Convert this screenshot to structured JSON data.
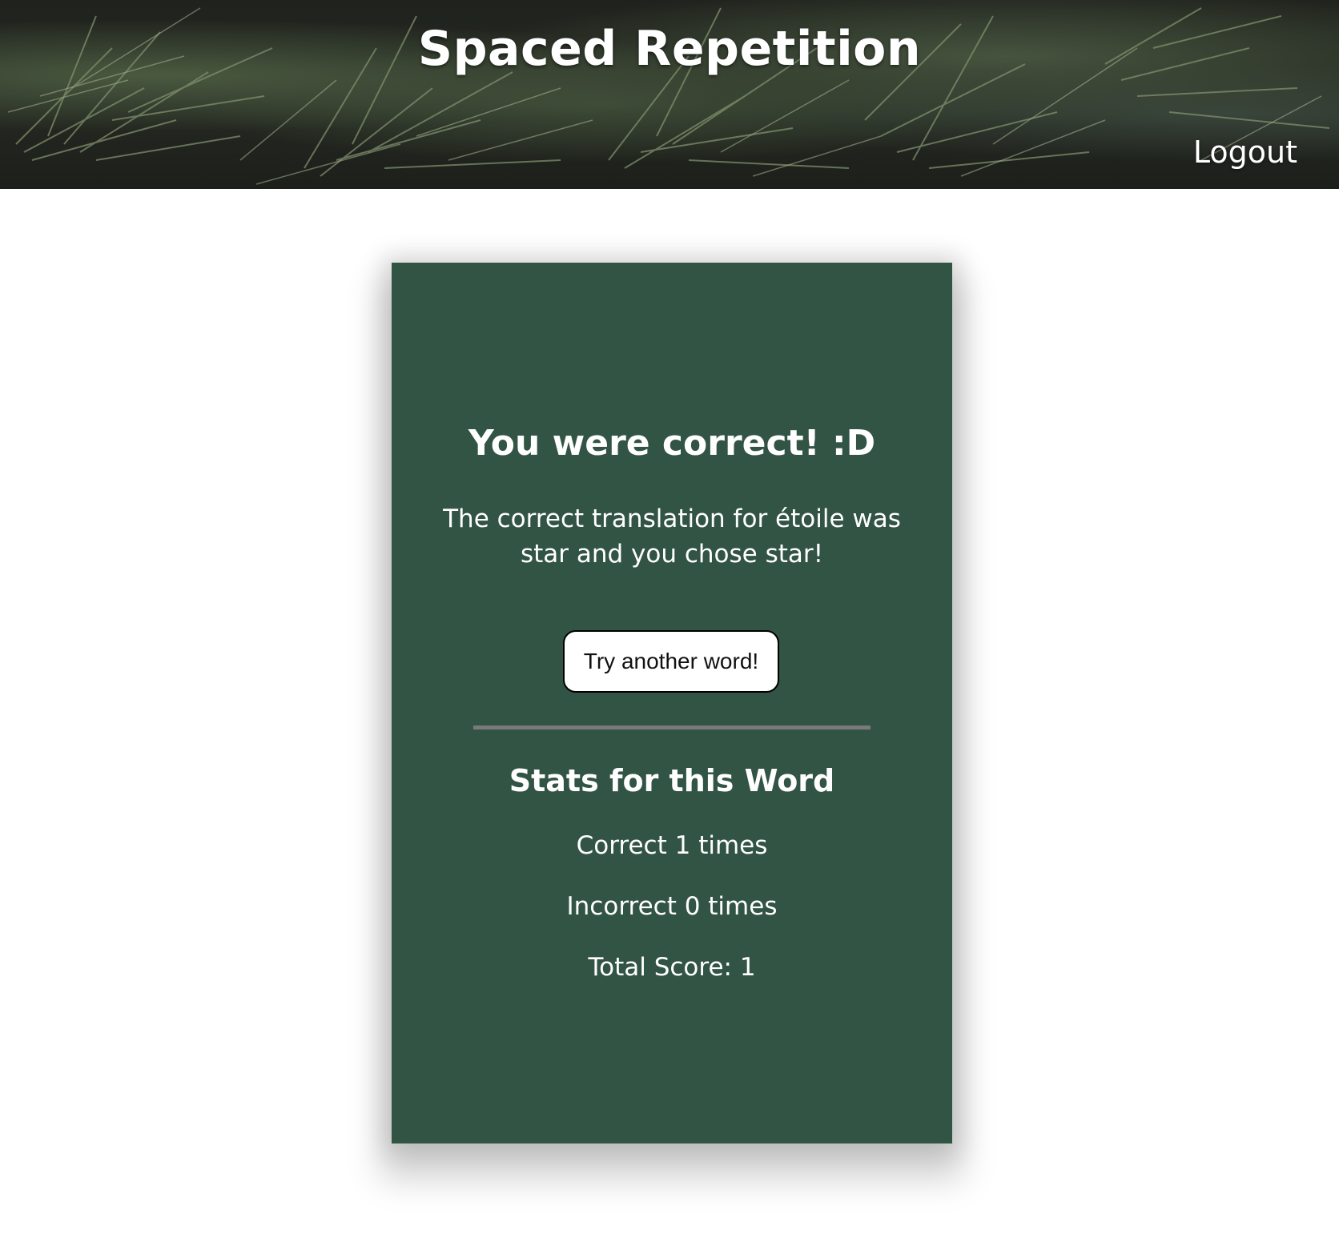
{
  "header": {
    "title": "Spaced Repetition",
    "logout_label": "Logout"
  },
  "feedback": {
    "heading": "You were correct! :D",
    "message": "The correct translation for étoile was star and you chose star!",
    "next_button_label": "Try another word!"
  },
  "stats": {
    "heading": "Stats for this Word",
    "correct": "Correct 1 times",
    "incorrect": "Incorrect 0 times",
    "total_score": "Total Score: 1"
  },
  "colors": {
    "card_background": "#325444",
    "header_background": "#22261f",
    "divider": "#7a7a7a"
  }
}
